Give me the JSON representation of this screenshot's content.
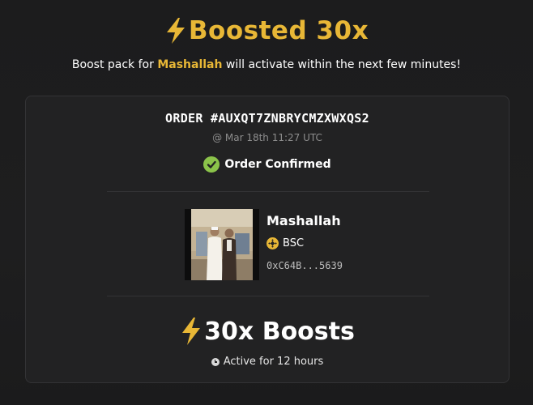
{
  "header": {
    "title": "Boosted 30x",
    "subtitle_prefix": "Boost pack for ",
    "subtitle_token": "Mashallah",
    "subtitle_suffix": " will activate within the next few minutes!"
  },
  "order": {
    "id": "ORDER #AUXQT7ZNBRYCMZXWXQS2",
    "timestamp": "@ Mar 18th 11:27 UTC",
    "status": "Order Confirmed"
  },
  "token": {
    "name": "Mashallah",
    "chain": "BSC",
    "address": "0xC64B...5639"
  },
  "boost": {
    "label": "30x Boosts",
    "duration": "Active for 12 hours"
  },
  "icons": {
    "title": "lightning-bolt-icon",
    "status": "check-circle-icon",
    "chain": "bnb-chain-icon",
    "boost": "lightning-bolt-icon",
    "duration": "clock-icon"
  },
  "colors": {
    "accent": "#e8b736",
    "success": "#8bc34a",
    "background": "#1c1c1d",
    "card": "#222223"
  }
}
